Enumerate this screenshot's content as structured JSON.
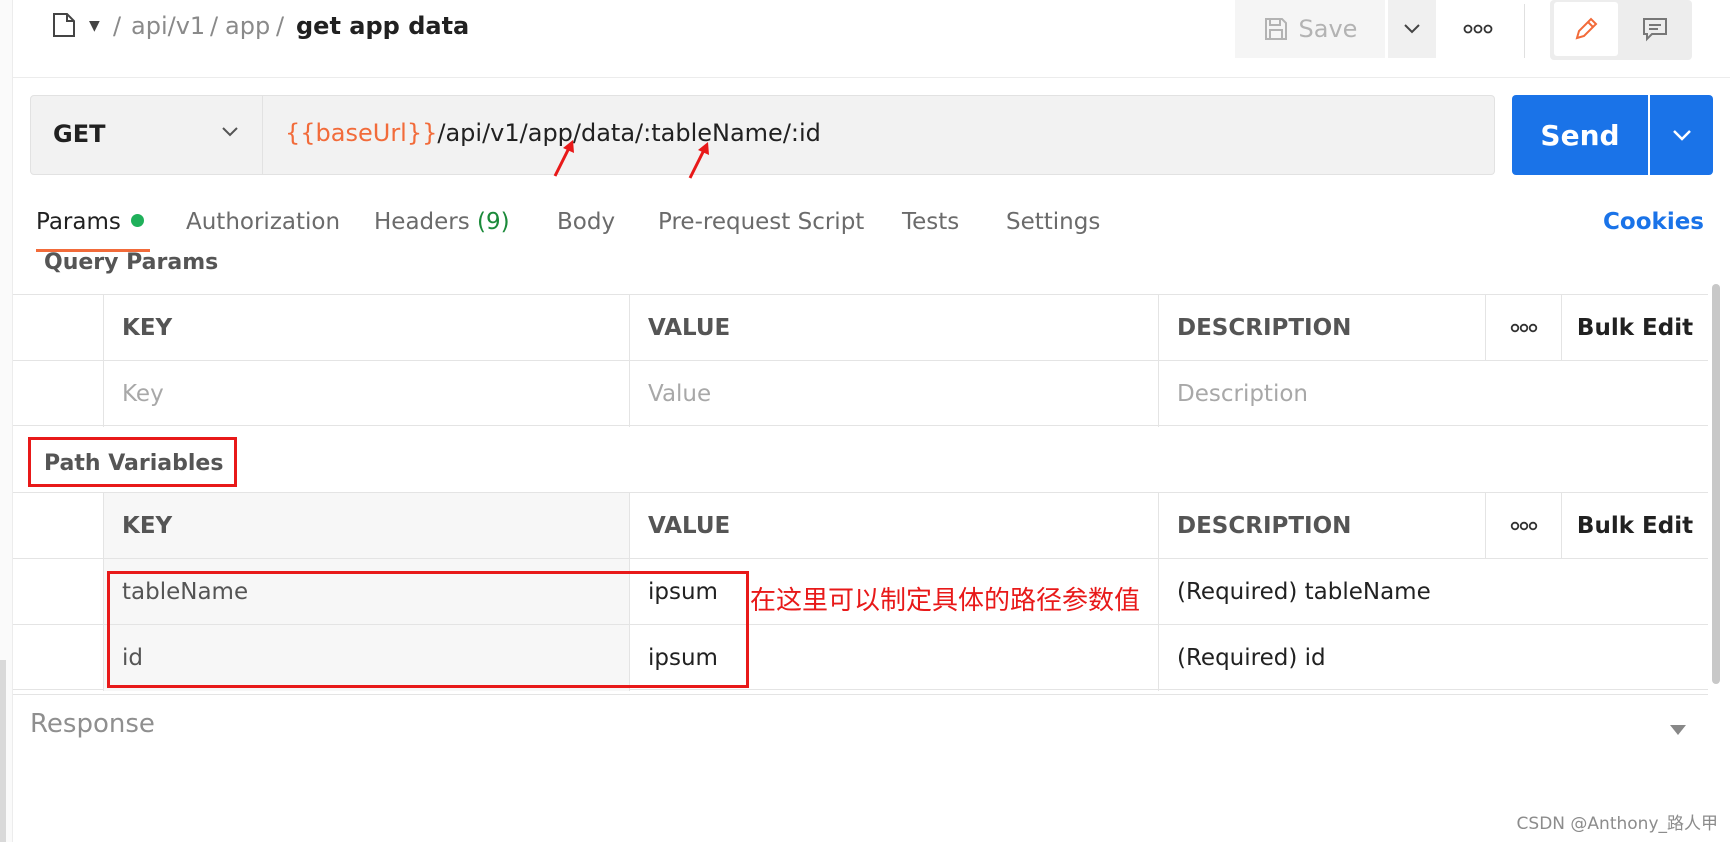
{
  "breadcrumb": {
    "items": [
      "api/v1",
      "app"
    ],
    "separator": "/",
    "current": "get app data"
  },
  "toolbar": {
    "save_label": "Save",
    "more_icon": "ooo"
  },
  "request": {
    "method": "GET",
    "url_variable": "{{baseUrl}}",
    "url_path": "/api/v1/app/data/:tableName/:id",
    "send_label": "Send"
  },
  "tabs": [
    {
      "label": "Params"
    },
    {
      "label": "Authorization"
    },
    {
      "label": "Headers",
      "count": "(9)"
    },
    {
      "label": "Body"
    },
    {
      "label": "Pre-request Script"
    },
    {
      "label": "Tests"
    },
    {
      "label": "Settings"
    }
  ],
  "cookies_label": "Cookies",
  "query_params": {
    "title": "Query Params",
    "headers": {
      "key": "KEY",
      "value": "VALUE",
      "description": "DESCRIPTION",
      "more": "ooo",
      "bulk_edit": "Bulk Edit"
    },
    "placeholder_row": {
      "key": "Key",
      "value": "Value",
      "description": "Description"
    }
  },
  "path_variables": {
    "title": "Path Variables",
    "headers": {
      "key": "KEY",
      "value": "VALUE",
      "description": "DESCRIPTION",
      "more": "ooo",
      "bulk_edit": "Bulk Edit"
    },
    "rows": [
      {
        "key": "tableName",
        "value": "ipsum",
        "description": "(Required) tableName"
      },
      {
        "key": "id",
        "value": "ipsum",
        "description": "(Required) id"
      }
    ]
  },
  "annotation": "在这里可以制定具体的路径参数值",
  "response_label": "Response",
  "watermark": "CSDN @Anthony_路人甲",
  "colors": {
    "accent": "#1a73e8",
    "variable": "#f26b3a",
    "annotation": "#e81919",
    "active_dot": "#1fb05a"
  }
}
